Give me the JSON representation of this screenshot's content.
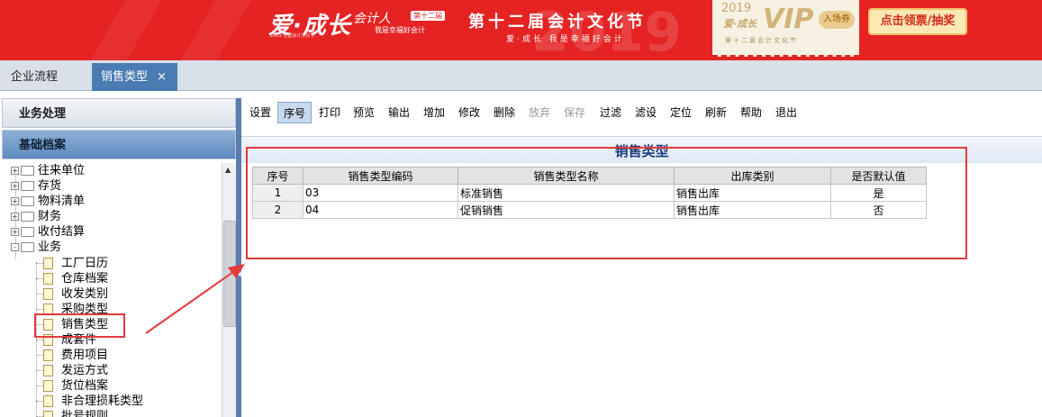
{
  "banner": {
    "logo": "爱·成长",
    "script": "会计人",
    "badge": "第十二届",
    "slogan": "我是幸福好会计",
    "tiny": "2019 全国会计文化节",
    "festival": "第十二届会计文化节",
    "festival_sub": "爱·成长  我是幸福好会计",
    "year_bg": "2019",
    "ticket": {
      "year": "2019",
      "brand": "爱·成长",
      "vip": "VIP",
      "pass": "入场券",
      "sub": "第十二届会计文化节"
    },
    "cta_label": "点击领票/抽奖",
    "colors": {
      "background": "#e52323",
      "cta_text": "#d22a1a"
    }
  },
  "tabs": [
    {
      "label": "企业流程"
    },
    {
      "label": "销售类型",
      "close": "×",
      "active": true
    }
  ],
  "nav": {
    "sections": [
      "业务处理",
      "基础档案"
    ],
    "tree": [
      {
        "label": "往来单位",
        "expand": "+"
      },
      {
        "label": "存货",
        "expand": "+"
      },
      {
        "label": "物料清单",
        "expand": "+"
      },
      {
        "label": "财务",
        "expand": "+"
      },
      {
        "label": "收付结算",
        "expand": "+"
      },
      {
        "label": "业务",
        "expand": "-"
      },
      {
        "label": "工厂日历"
      },
      {
        "label": "仓库档案"
      },
      {
        "label": "收发类别"
      },
      {
        "label": "采购类型"
      },
      {
        "label": "销售类型",
        "selected": true
      },
      {
        "label": "成套件"
      },
      {
        "label": "费用项目"
      },
      {
        "label": "发运方式"
      },
      {
        "label": "货位档案"
      },
      {
        "label": "非合理损耗类型"
      },
      {
        "label": "批号规则"
      }
    ]
  },
  "toolbar": [
    {
      "label": "设置"
    },
    {
      "label": "序号",
      "active": true
    },
    {
      "label": "打印"
    },
    {
      "label": "预览"
    },
    {
      "label": "输出"
    },
    {
      "label": "增加"
    },
    {
      "label": "修改"
    },
    {
      "label": "删除"
    },
    {
      "label": "放弃",
      "disabled": true
    },
    {
      "label": "保存",
      "disabled": true
    },
    {
      "label": "过滤"
    },
    {
      "label": "滤设"
    },
    {
      "label": "定位"
    },
    {
      "label": "刷新"
    },
    {
      "label": "帮助"
    },
    {
      "label": "退出"
    }
  ],
  "form": {
    "title": "销售类型",
    "columns": [
      "序号",
      "销售类型编码",
      "销售类型名称",
      "出库类别",
      "是否默认值"
    ],
    "rows": [
      [
        "1",
        "03",
        "标准销售",
        "销售出库",
        "是"
      ],
      [
        "2",
        "04",
        "促销销售",
        "销售出库",
        "否"
      ]
    ]
  },
  "annotation_color": "#e23b3b"
}
